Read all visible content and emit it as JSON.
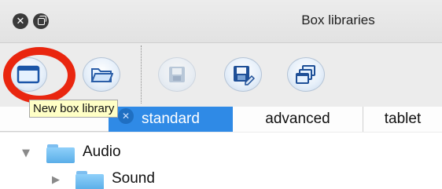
{
  "window": {
    "title": "Box libraries",
    "close_glyph": "✕"
  },
  "toolbar": {
    "buttons": [
      {
        "name": "new-box-library",
        "icon": "window-icon"
      },
      {
        "name": "open-box-library",
        "icon": "folder-icon"
      },
      {
        "name": "save-box-library",
        "icon": "disk-icon",
        "disabled": true
      },
      {
        "name": "save-as-box-library",
        "icon": "disk-edit-icon"
      },
      {
        "name": "duplicate-box-library",
        "icon": "stacked-windows-icon"
      }
    ],
    "tooltip": "New box library",
    "highlight_color": "#e9260f"
  },
  "tabs": {
    "items": [
      {
        "label": "standard",
        "selected": true
      },
      {
        "label": "advanced",
        "selected": false
      },
      {
        "label": "tablet",
        "selected": false
      }
    ],
    "close_glyph": "✕",
    "accent_color": "#2f8ae6"
  },
  "tree": {
    "items": [
      {
        "label": "Audio",
        "expanded": true,
        "disclosure": "▼"
      },
      {
        "label": "Sound",
        "expanded": false,
        "disclosure": "▶"
      }
    ]
  }
}
